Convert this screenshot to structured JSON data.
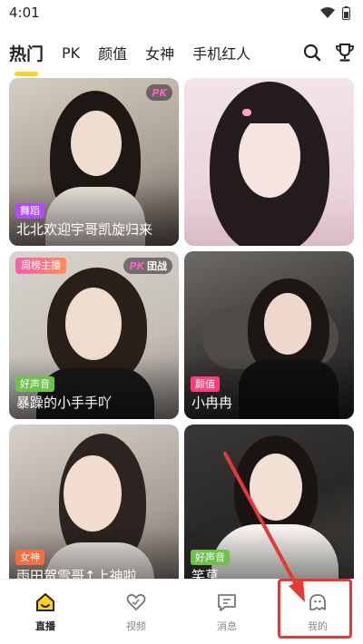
{
  "status": {
    "time": "4:01"
  },
  "tabs": [
    {
      "label": "热门",
      "active": true
    },
    {
      "label": "PK"
    },
    {
      "label": "颜值"
    },
    {
      "label": "女神"
    },
    {
      "label": "手机红人"
    }
  ],
  "cards": [
    {
      "tag": "舞蹈",
      "tag_color": "#b04cff",
      "title": "北北欢迎宇哥凯旋归来",
      "pk_badge": "PK"
    },
    {
      "title": ""
    },
    {
      "rank": "周榜主播",
      "pk_badge": "PK",
      "pk_text": "团战",
      "tag": "好声音",
      "tag_color": "#6cc24a",
      "title": "暴躁的小手手吖"
    },
    {
      "tag": "颜值",
      "tag_color": "#ff3d7f",
      "title": "小冉冉"
    },
    {
      "tag": "女神",
      "tag_color": "#ff6a3d",
      "title": "雨田贺雪哥↑上神啦"
    },
    {
      "tag": "好声音",
      "tag_color": "#6cc24a",
      "title": "笑草"
    }
  ],
  "nav": [
    {
      "label": "直播",
      "icon": "home-icon",
      "active": true
    },
    {
      "label": "视频",
      "icon": "heart-icon"
    },
    {
      "label": "消息",
      "icon": "message-icon"
    },
    {
      "label": "我的",
      "icon": "profile-icon"
    }
  ],
  "colors": {
    "accent": "#ffd21e",
    "annotation": "#e53935"
  }
}
